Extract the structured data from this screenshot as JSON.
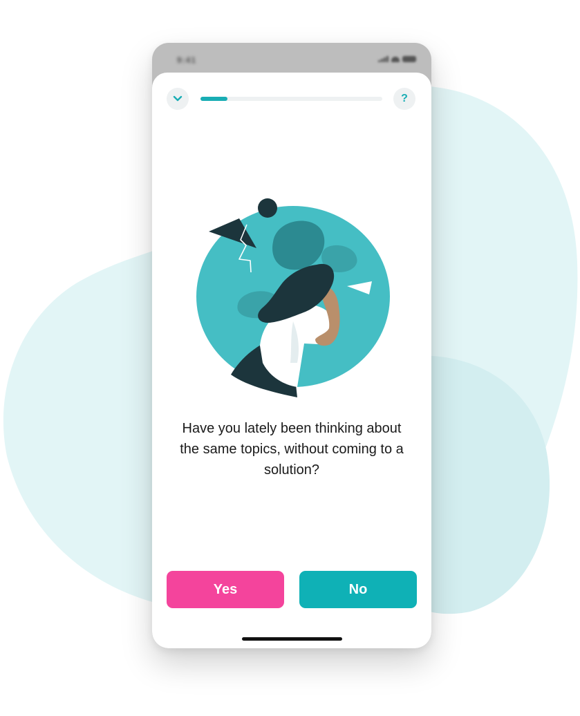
{
  "status_bar": {
    "time": "9:41"
  },
  "header": {
    "collapse_icon": "chevron-down-icon",
    "help_label": "?",
    "progress": 0.15
  },
  "question": {
    "text": "Have you lately been thinking about the same topics, without coming to a solution?"
  },
  "answers": {
    "yes_label": "Yes",
    "no_label": "No"
  },
  "colors": {
    "accent": "#19adb4",
    "yes_button": "#f4449c",
    "no_button": "#0fb1b6",
    "illustration_circle": "#45bec4",
    "background_blob": "#e2f5f6"
  }
}
